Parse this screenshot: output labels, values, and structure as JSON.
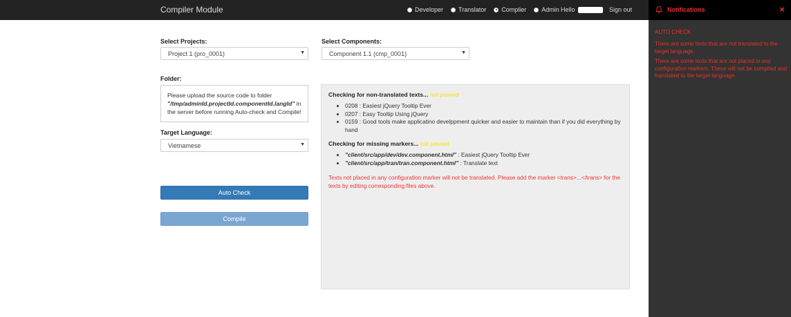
{
  "app": {
    "title": "Compiler Module"
  },
  "nav": {
    "roles": [
      {
        "label": "Developer",
        "selected": false
      },
      {
        "label": "Translator",
        "selected": false
      },
      {
        "label": "Complier",
        "selected": true
      },
      {
        "label": "Admin",
        "selected": false
      }
    ],
    "hello": "Hello",
    "signout": "Sign out"
  },
  "form": {
    "projects_label": "Select Projects:",
    "projects_value": "Project 1 (pro_0001)",
    "components_label": "Select Components:",
    "components_value": "Component 1.1 (cmp_0001)",
    "folder_label": "Folder:",
    "folder_pre": "Please upload the source code to folder",
    "folder_path": "\"/tmp/adminId.projectId.componentId.langId\"",
    "folder_mid": " in",
    "folder_post": "the server before running Auto-check and Compile!",
    "language_label": "Target Language:",
    "language_value": "Vietnamese",
    "autocheck_label": "Auto Check",
    "compile_label": "Compile"
  },
  "result": {
    "nontranslated_heading": "Checking for non-translated texts...",
    "nontranslated_status": "not passed",
    "nontranslated_items": [
      {
        "text": "0208 : Easiest jQuery Tooltip Ever"
      },
      {
        "text": "0207 : Easy Tooltip Using jQuery"
      },
      {
        "text": "0159 : Good tools make applicatino develppment quicker and easier to maintain than if you did everything by hand"
      }
    ],
    "markers_heading": "Checking for missing markers...",
    "markers_status": "not passed",
    "markers_items": [
      {
        "file": "\"client/src/app/dev/dev.component.html\"",
        "text": " : Easiest jQuery Tooltip Ever"
      },
      {
        "file": "\"client/src/app/tran/tran.component.html\"",
        "text": " : Translate text"
      }
    ],
    "warning": "Texts not placed in any configuration marker will not be translated. Please add the marker <trans>...</trans> for the texts by editing corresponding files above."
  },
  "notifications": {
    "title": "Notifications",
    "close": "×",
    "section": "AUTO CHECK",
    "messages": [
      "There are some texts that are not translated to the target language.",
      "There are some texts that are not placed in any configuration markers. These will not be compiled and translated to the target language."
    ]
  },
  "colors": {
    "accent": "#337ab7",
    "alert": "#e6322b",
    "status": "#ffdd00"
  }
}
